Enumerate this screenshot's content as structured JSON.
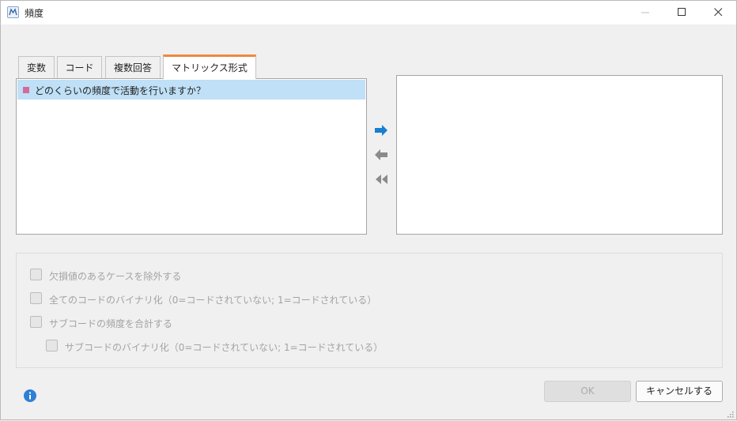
{
  "window": {
    "title": "頻度",
    "icon": "app-icon"
  },
  "tabs": [
    {
      "label": "変数",
      "active": false
    },
    {
      "label": "コード",
      "active": false
    },
    {
      "label": "複数回答",
      "active": false
    },
    {
      "label": "マトリックス形式",
      "active": true
    }
  ],
  "source_list": {
    "items": [
      {
        "label": "どのくらいの頻度で活動を行いますか？",
        "selected": true,
        "marker_color": "#d46a9b"
      }
    ]
  },
  "target_list": {
    "items": []
  },
  "transfer_buttons": {
    "add_icon": "arrow-right-icon",
    "remove_icon": "arrow-left-icon",
    "remove_all_icon": "double-arrow-left-icon"
  },
  "options": {
    "exclude_missing": "欠損値のあるケースを除外する",
    "binarize_all": "全てのコードのバイナリ化（0=コードされていない; 1=コードされている）",
    "sum_subcodes": "サブコードの頻度を合計する",
    "binarize_subcodes": "サブコードのバイナリ化（0=コードされていない; 1=コードされている）"
  },
  "buttons": {
    "ok": "OK",
    "cancel": "キャンセルする"
  },
  "colors": {
    "accent_tab": "#f0883e",
    "selection": "#bfe0f6",
    "arrow_active": "#1a7fd1",
    "arrow_disabled": "#8a8a8a",
    "info": "#2f7fd6"
  }
}
